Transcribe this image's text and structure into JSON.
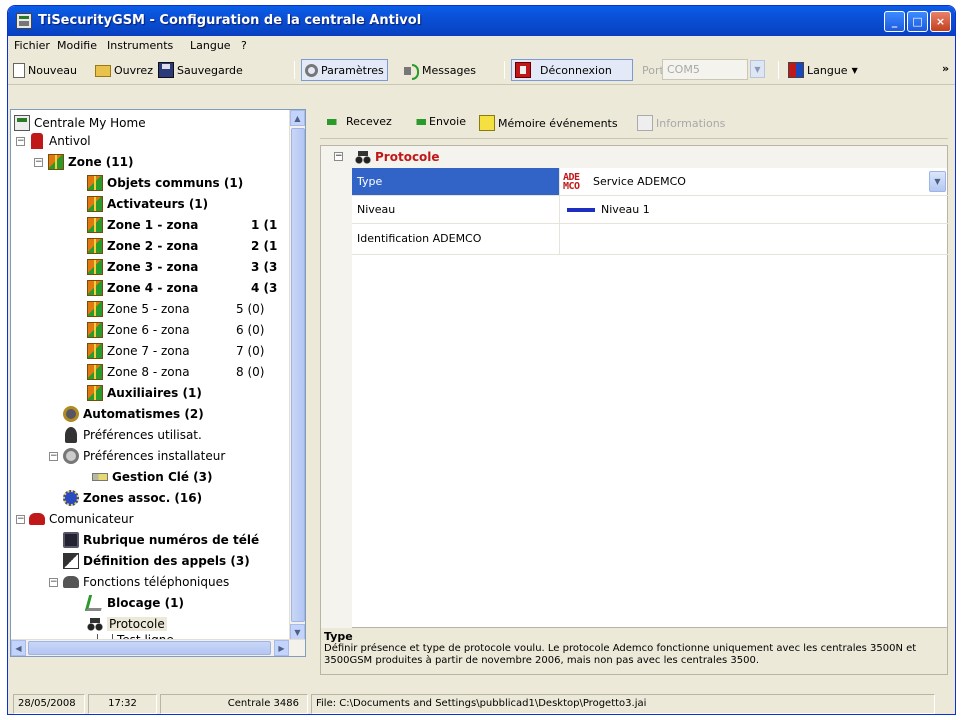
{
  "window": {
    "title": "TiSecurityGSM - Configuration de la centrale Antivol",
    "btn_min": "_",
    "btn_max": "□",
    "btn_close": "×"
  },
  "menu": [
    "Fichier",
    "Modifie",
    "Instruments",
    "Langue",
    "?"
  ],
  "toolbar": {
    "new": "Nouveau",
    "open": "Ouvrez",
    "save": "Sauvegarde",
    "params": "Paramètres",
    "messages": "Messages",
    "disconnect": "Déconnexion",
    "port_label": "Porte",
    "port_value": "COM5",
    "language": "Langue",
    "overflow": "»"
  },
  "tree": {
    "root": "Centrale My Home",
    "antivol": "Antivol",
    "zone": "Zone (11)",
    "items": [
      {
        "label": "Objets communs (1)",
        "count": ""
      },
      {
        "label": "Activateurs (1)",
        "count": ""
      },
      {
        "label": "Zone 1 - zona",
        "count": "1 (1"
      },
      {
        "label": "Zone 2 - zona",
        "count": "2 (1"
      },
      {
        "label": "Zone 3 - zona",
        "count": "3 (3"
      },
      {
        "label": "Zone 4 - zona",
        "count": "4 (3"
      },
      {
        "label": "Zone 5 - zona",
        "count": "5 (0)"
      },
      {
        "label": "Zone 6 - zona",
        "count": "6 (0)"
      },
      {
        "label": "Zone 7 - zona",
        "count": "7 (0)"
      },
      {
        "label": "Zone 8 - zona",
        "count": "8 (0)"
      },
      {
        "label": "Auxiliaires (1)",
        "count": ""
      }
    ],
    "automatismes": "Automatismes (2)",
    "pref_user": "Préférences utilisat.",
    "pref_installer": "Préférences installateur",
    "gestion_cle": "Gestion Clé (3)",
    "zones_assoc": "Zones assoc. (16)",
    "comunicateur": "Comunicateur",
    "rubrique": "Rubrique numéros de télé",
    "definition": "Définition des appels (3)",
    "fonctions": "Fonctions téléphoniques",
    "blocage": "Blocage (1)",
    "protocole": "Protocole",
    "test_ligne": "Test ligne"
  },
  "subtoolbar": {
    "receive": "Recevez",
    "send": "Envoie",
    "memory": "Mémoire événements",
    "info": "Informations"
  },
  "grid": {
    "category": "Protocole",
    "rows": [
      {
        "name": "Type",
        "value": "Service ADEMCO",
        "logo_top": "ADE",
        "logo_bottom": "MCO"
      },
      {
        "name": "Niveau",
        "value": "Niveau 1"
      },
      {
        "name": "Identification ADEMCO",
        "value": ""
      }
    ]
  },
  "help": {
    "title": "Type",
    "text": "Définir présence et type de protocole voulu. Le protocole Ademco fonctionne uniquement avec les centrales 3500N et 3500GSM produites à partir de novembre 2006, mais non pas avec les centrales 3500."
  },
  "status": {
    "date": "28/05/2008",
    "time": "17:32",
    "unit": "Centrale 3486",
    "file": "File: C:\\Documents and Settings\\pubblicad1\\Desktop\\Progetto3.jai"
  },
  "colors": {
    "title_blue": "#0a4fd6",
    "selection": "#3264c8",
    "category_red": "#c01818"
  }
}
